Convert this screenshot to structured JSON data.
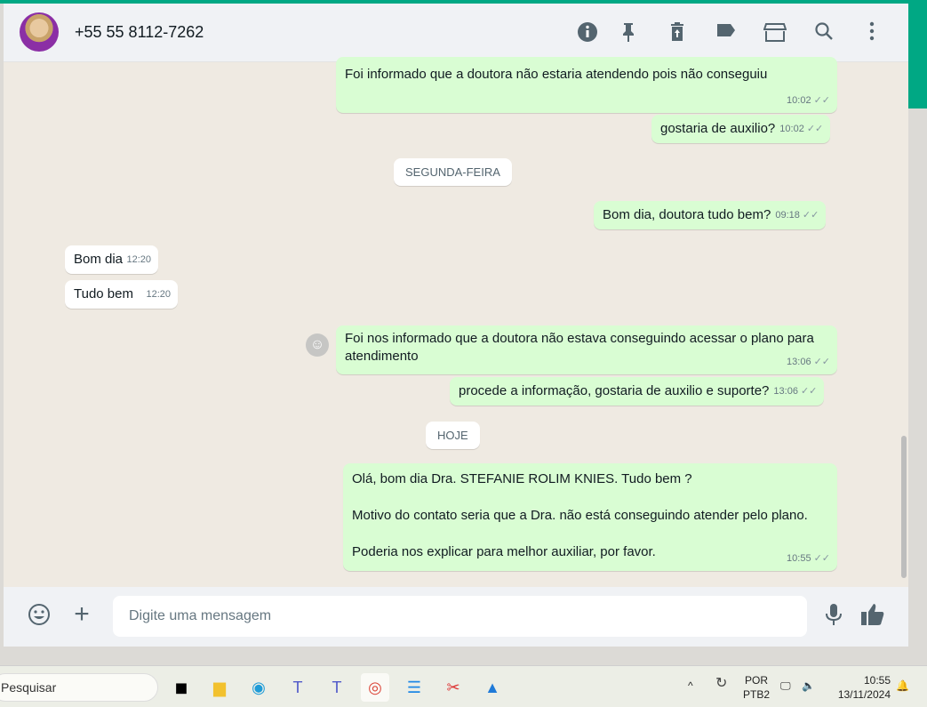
{
  "header": {
    "contact": "+55 55 8112-7262",
    "icons": [
      "info-icon",
      "pin-icon",
      "delete-icon",
      "label-icon",
      "store-icon",
      "search-icon",
      "menu-icon"
    ]
  },
  "messages": [
    {
      "dir": "out",
      "text": "Foi informado que a doutora não estaria atendendo pois não conseguiu",
      "time": "10:02"
    },
    {
      "dir": "out",
      "text": "gostaria de auxilio?",
      "time": "10:02"
    },
    {
      "dir": "out",
      "text": "Bom dia, doutora tudo bem?",
      "time": "09:18"
    },
    {
      "dir": "in",
      "text": "Bom dia",
      "time": "12:20"
    },
    {
      "dir": "in",
      "text": "Tudo bem",
      "time": "12:20"
    },
    {
      "dir": "out",
      "text": "Foi nos informado que a doutora não estava conseguindo acessar o plano para atendimento",
      "time": "13:06"
    },
    {
      "dir": "out",
      "text": "procede a informação, gostaria de auxilio e suporte?",
      "time": "13:06"
    },
    {
      "dir": "out",
      "lines": [
        "Olá, bom dia Dra. STEFANIE ROLIM KNIES. Tudo bem ?",
        "Motivo do contato seria que a Dra. não está conseguindo atender pelo plano.",
        "Poderia nos explicar para melhor auxiliar, por favor."
      ],
      "time": "10:55"
    }
  ],
  "dates": {
    "monday": "SEGUNDA-FEIRA",
    "today": "HOJE"
  },
  "footer": {
    "placeholder": "Digite uma mensagem"
  },
  "taskbar": {
    "search": "Pesquisar",
    "lang": "POR",
    "layout": "PTB2",
    "time": "10:55",
    "date": "13/11/2024"
  },
  "colors": {
    "accent": "#00a884",
    "outgoing": "#d9fdd3"
  }
}
